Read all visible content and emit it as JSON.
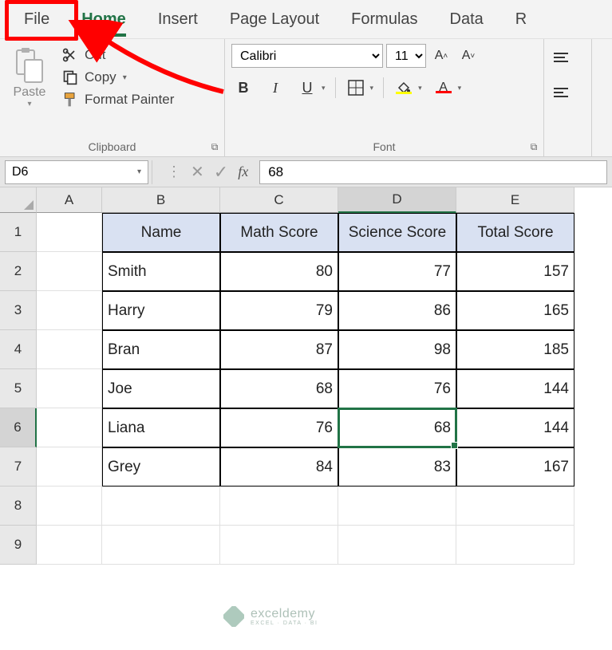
{
  "tabs": {
    "file": "File",
    "home": "Home",
    "insert": "Insert",
    "page_layout": "Page Layout",
    "formulas": "Formulas",
    "data": "Data",
    "last": "R"
  },
  "clipboard": {
    "paste": "Paste",
    "cut": "Cut",
    "copy": "Copy",
    "format_painter": "Format Painter",
    "group_label": "Clipboard"
  },
  "font": {
    "name": "Calibri",
    "size": "11",
    "bold": "B",
    "italic": "I",
    "underline": "U",
    "increase": "A˄",
    "decrease": "A˅",
    "group_label": "Font"
  },
  "namebox": "D6",
  "formula_value": "68",
  "columns": [
    "A",
    "B",
    "C",
    "D",
    "E"
  ],
  "rows": [
    "1",
    "2",
    "3",
    "4",
    "5",
    "6",
    "7",
    "8",
    "9"
  ],
  "table": {
    "headers": [
      "Name",
      "Math Score",
      "Science Score",
      "Total Score"
    ],
    "data": [
      [
        "Smith",
        "80",
        "77",
        "157"
      ],
      [
        "Harry",
        "79",
        "86",
        "165"
      ],
      [
        "Bran",
        "87",
        "98",
        "185"
      ],
      [
        "Joe",
        "68",
        "76",
        "144"
      ],
      [
        "Liana",
        "76",
        "68",
        "144"
      ],
      [
        "Grey",
        "84",
        "83",
        "167"
      ]
    ]
  },
  "watermark": {
    "brand": "exceldemy",
    "tagline": "EXCEL · DATA · BI"
  },
  "chart_data": {
    "type": "table",
    "title": "",
    "columns": [
      "Name",
      "Math Score",
      "Science Score",
      "Total Score"
    ],
    "rows": [
      {
        "Name": "Smith",
        "Math Score": 80,
        "Science Score": 77,
        "Total Score": 157
      },
      {
        "Name": "Harry",
        "Math Score": 79,
        "Science Score": 86,
        "Total Score": 165
      },
      {
        "Name": "Bran",
        "Math Score": 87,
        "Science Score": 98,
        "Total Score": 185
      },
      {
        "Name": "Joe",
        "Math Score": 68,
        "Science Score": 76,
        "Total Score": 144
      },
      {
        "Name": "Liana",
        "Math Score": 76,
        "Science Score": 68,
        "Total Score": 144
      },
      {
        "Name": "Grey",
        "Math Score": 84,
        "Science Score": 83,
        "Total Score": 167
      }
    ]
  }
}
